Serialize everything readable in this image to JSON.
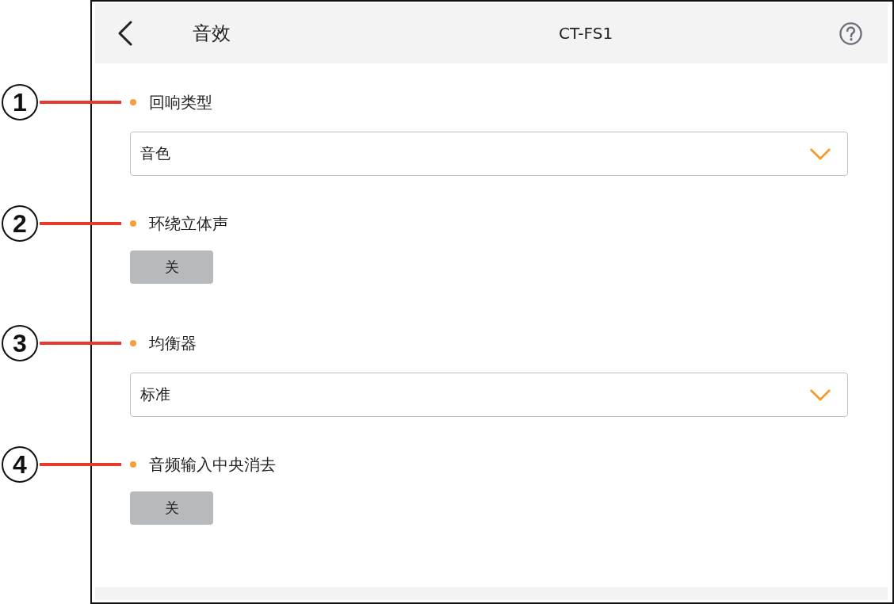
{
  "header": {
    "title": "音效",
    "device": "CT-FS1"
  },
  "settings": [
    {
      "callout": "1",
      "label": "回响类型",
      "kind": "dropdown",
      "value": "音色"
    },
    {
      "callout": "2",
      "label": "环绕立体声",
      "kind": "toggle",
      "value": "关",
      "on": false
    },
    {
      "callout": "3",
      "label": "均衡器",
      "kind": "dropdown",
      "value": "标准"
    },
    {
      "callout": "4",
      "label": "音频输入中央消去",
      "kind": "toggle",
      "value": "关",
      "on": false
    }
  ]
}
